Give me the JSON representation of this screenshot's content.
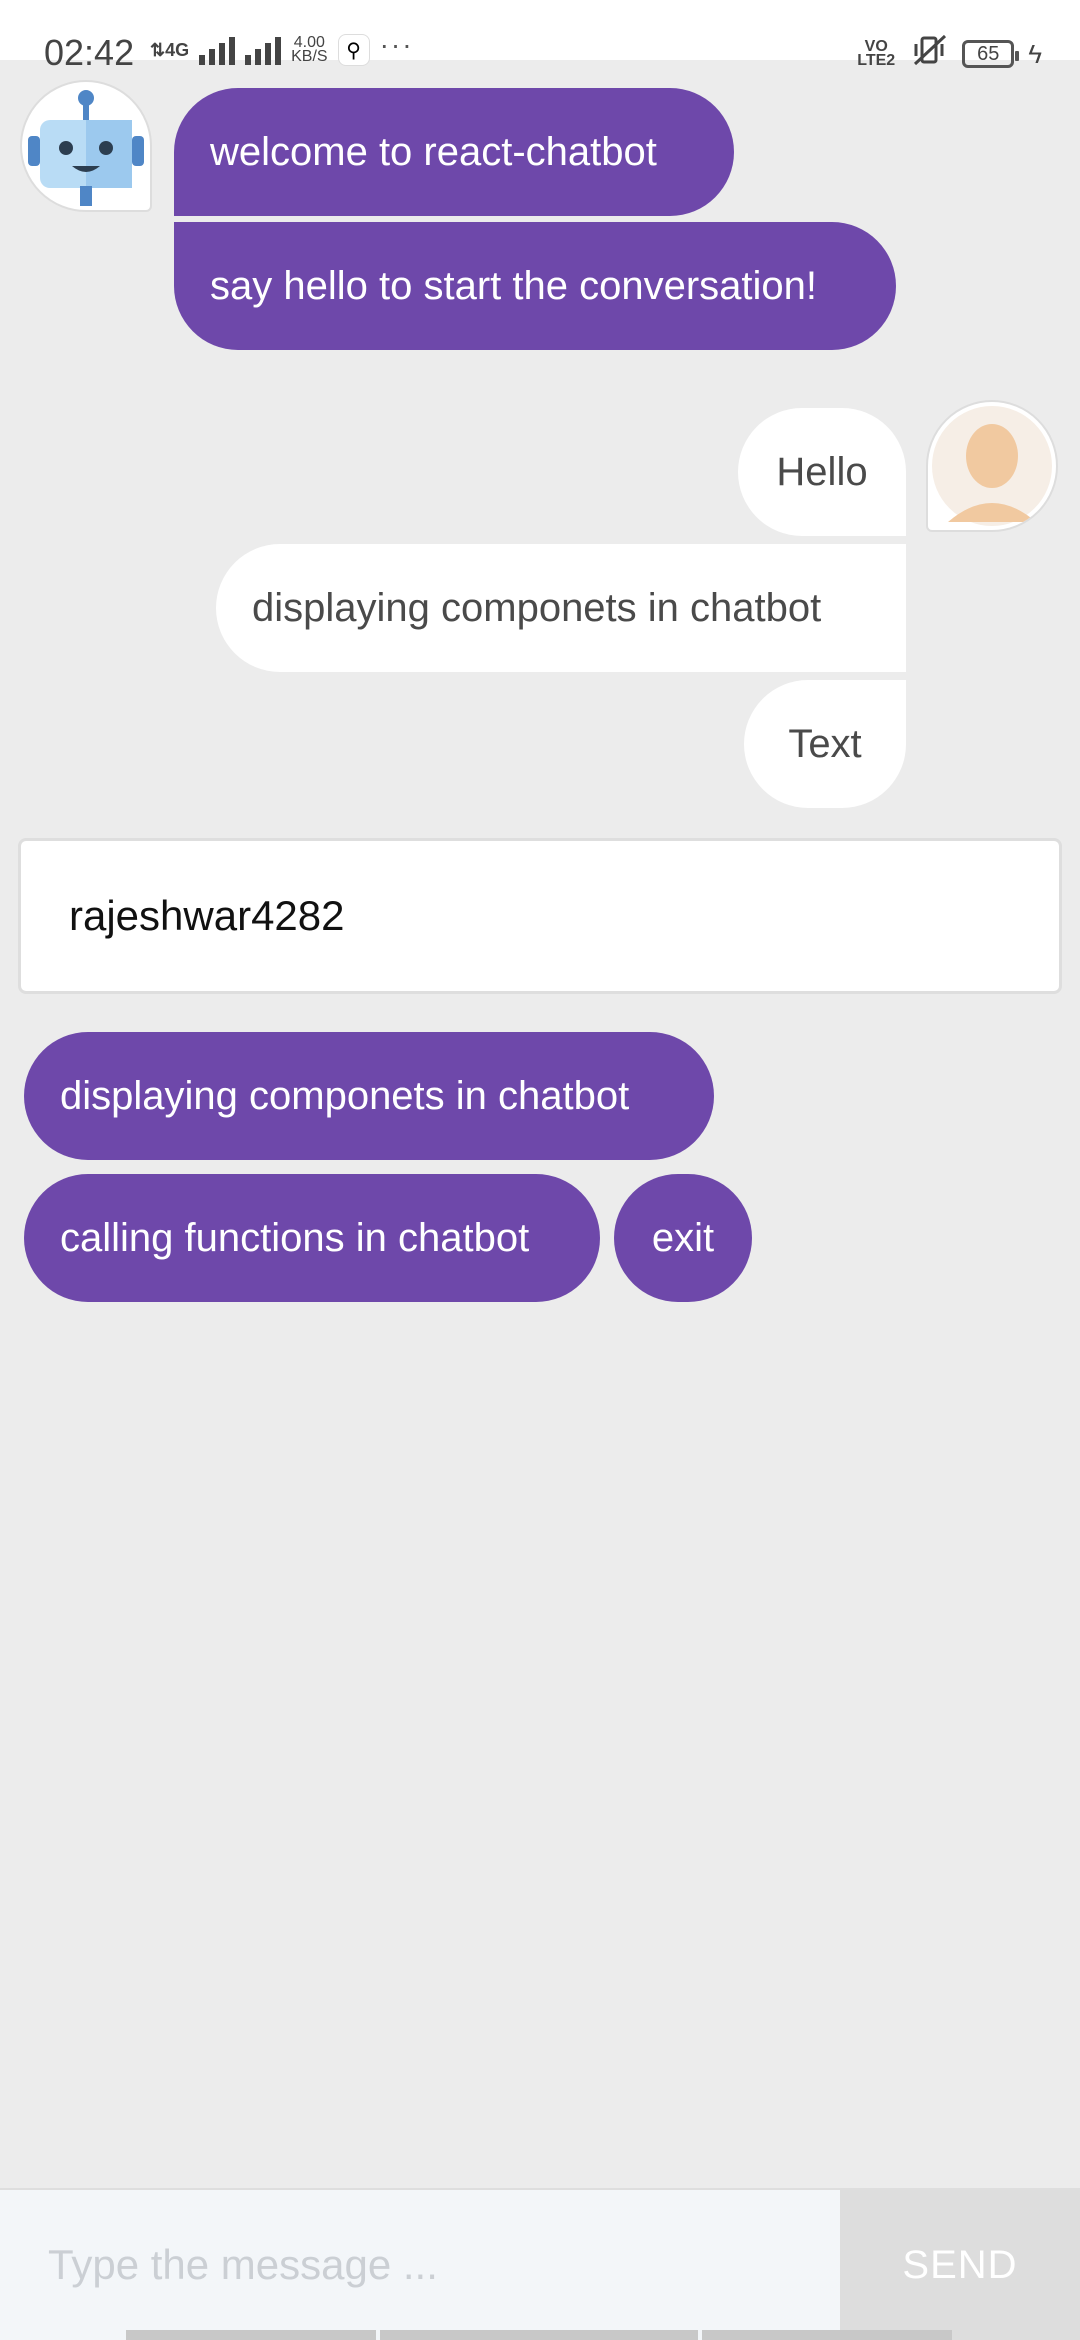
{
  "status_bar": {
    "time": "02:42",
    "network_type": "4G",
    "speed_value": "4.00",
    "speed_unit": "KB/S",
    "more": "···",
    "volte": "VO LTE2",
    "battery": "65",
    "icons": [
      "data-arrows-icon",
      "signal-icon",
      "signal-icon",
      "app-notification-icon",
      "vibrate-icon",
      "battery-icon",
      "charging-icon"
    ]
  },
  "chat": {
    "bot_messages": [
      "welcome to react-chatbot",
      "say hello to start the conversation!"
    ],
    "user_messages": [
      "Hello",
      "displaying componets in chatbot",
      "Text"
    ],
    "username_card": "rajeshwar4282",
    "options": [
      "displaying componets in chatbot",
      "calling functions in chatbot",
      "exit"
    ]
  },
  "footer": {
    "input_placeholder": "Type the message ...",
    "send_label": "SEND"
  },
  "colors": {
    "bot_bubble": "#6e48aa",
    "user_bubble": "#ffffff",
    "background": "#ececec"
  }
}
